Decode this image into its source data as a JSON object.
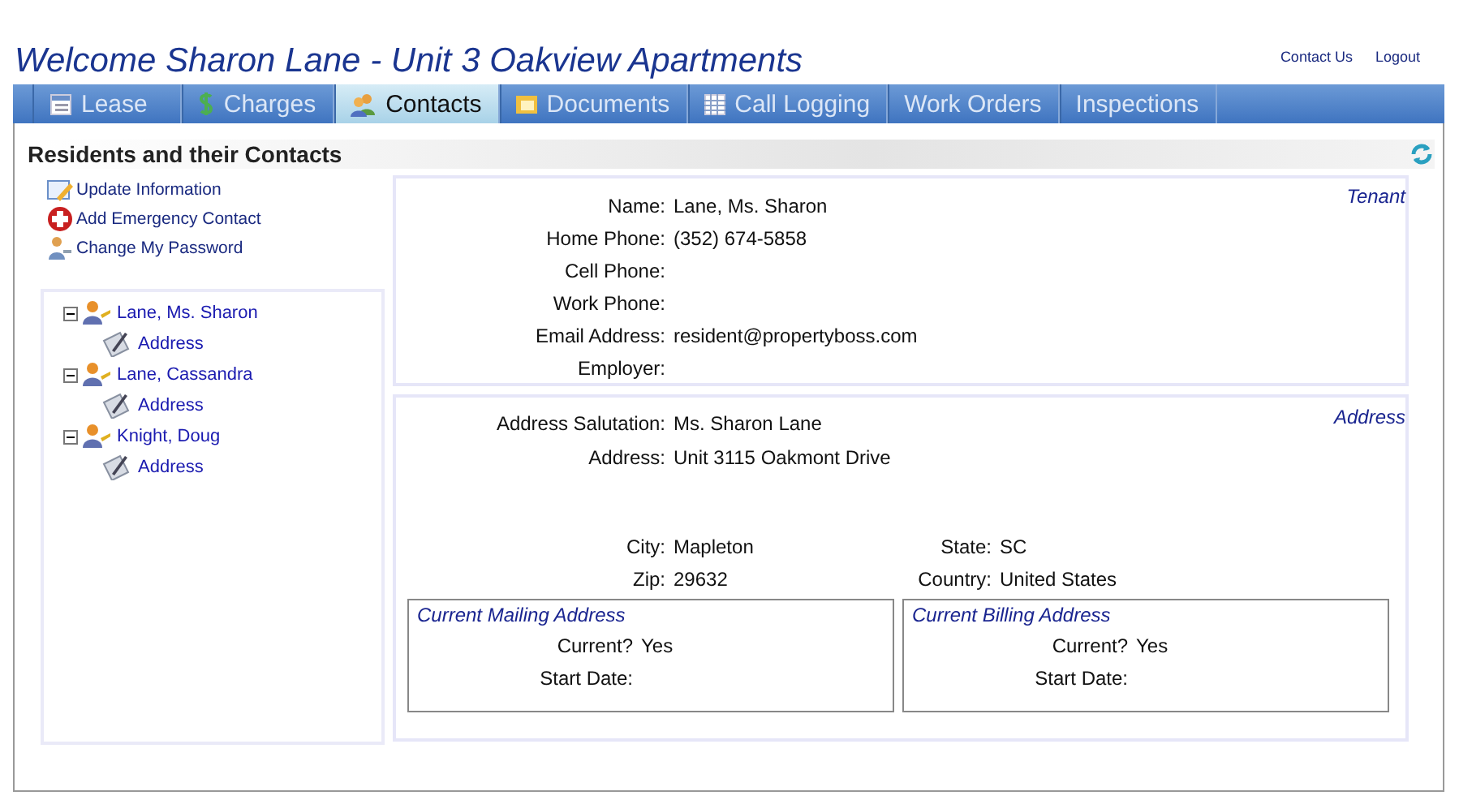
{
  "header": {
    "title": "Welcome Sharon Lane - Unit 3 Oakview Apartments",
    "links": [
      "Contact Us",
      "Logout"
    ]
  },
  "tabs": [
    {
      "label": "Lease",
      "kind": "icon",
      "selected": false
    },
    {
      "label": "Charges",
      "kind": "icon",
      "selected": false
    },
    {
      "label": "Contacts",
      "kind": "icon",
      "selected": true
    },
    {
      "label": "Documents",
      "kind": "icon",
      "selected": false
    },
    {
      "label": "Call Logging",
      "kind": "icon",
      "selected": false
    },
    {
      "label": "Work Orders",
      "kind": "plain",
      "selected": false
    },
    {
      "label": "Inspections",
      "kind": "plain",
      "selected": false
    }
  ],
  "section": {
    "title": "Residents and their Contacts"
  },
  "actions": [
    "Update Information",
    "Add Emergency Contact",
    "Change My Password"
  ],
  "tree": [
    {
      "label": "Lane, Ms. Sharon",
      "expanded": true,
      "children": [
        {
          "label": "Address"
        }
      ]
    },
    {
      "label": "Lane, Cassandra",
      "expanded": true,
      "children": [
        {
          "label": "Address"
        }
      ]
    },
    {
      "label": "Knight, Doug",
      "expanded": true,
      "children": [
        {
          "label": "Address"
        }
      ]
    }
  ],
  "contact_panel": {
    "tag": "Tenant",
    "fields": [
      {
        "label": "Name:",
        "value": "Lane, Ms. Sharon"
      },
      {
        "label": "Home Phone:",
        "value": "(352) 674-5858"
      },
      {
        "label": "Cell Phone:"
      },
      {
        "label": "Work Phone:"
      },
      {
        "label": "Email Address:",
        "value": "resident@propertyboss.com"
      },
      {
        "label": "Employer:"
      }
    ]
  },
  "address_panel": {
    "tag": "Address",
    "fields": [
      {
        "label": "Address Salutation:",
        "value": "Ms. Sharon Lane"
      },
      {
        "label": "Address:",
        "value": "Unit 3115 Oakmont Drive"
      }
    ],
    "grid": [
      {
        "label": "City:",
        "value": "Mapleton"
      },
      {
        "label": "State:",
        "value": "SC"
      },
      {
        "label": "Zip:",
        "value": "29632"
      },
      {
        "label": "Country:",
        "value": "United States"
      }
    ],
    "boxes": [
      {
        "title": "Current Mailing Address",
        "fields": [
          {
            "label": "Current?",
            "value": "Yes"
          },
          {
            "label": "Start Date:"
          }
        ]
      },
      {
        "title": "Current Billing Address",
        "fields": [
          {
            "label": "Current?",
            "value": "Yes"
          },
          {
            "label": "Start Date:"
          }
        ]
      }
    ]
  }
}
